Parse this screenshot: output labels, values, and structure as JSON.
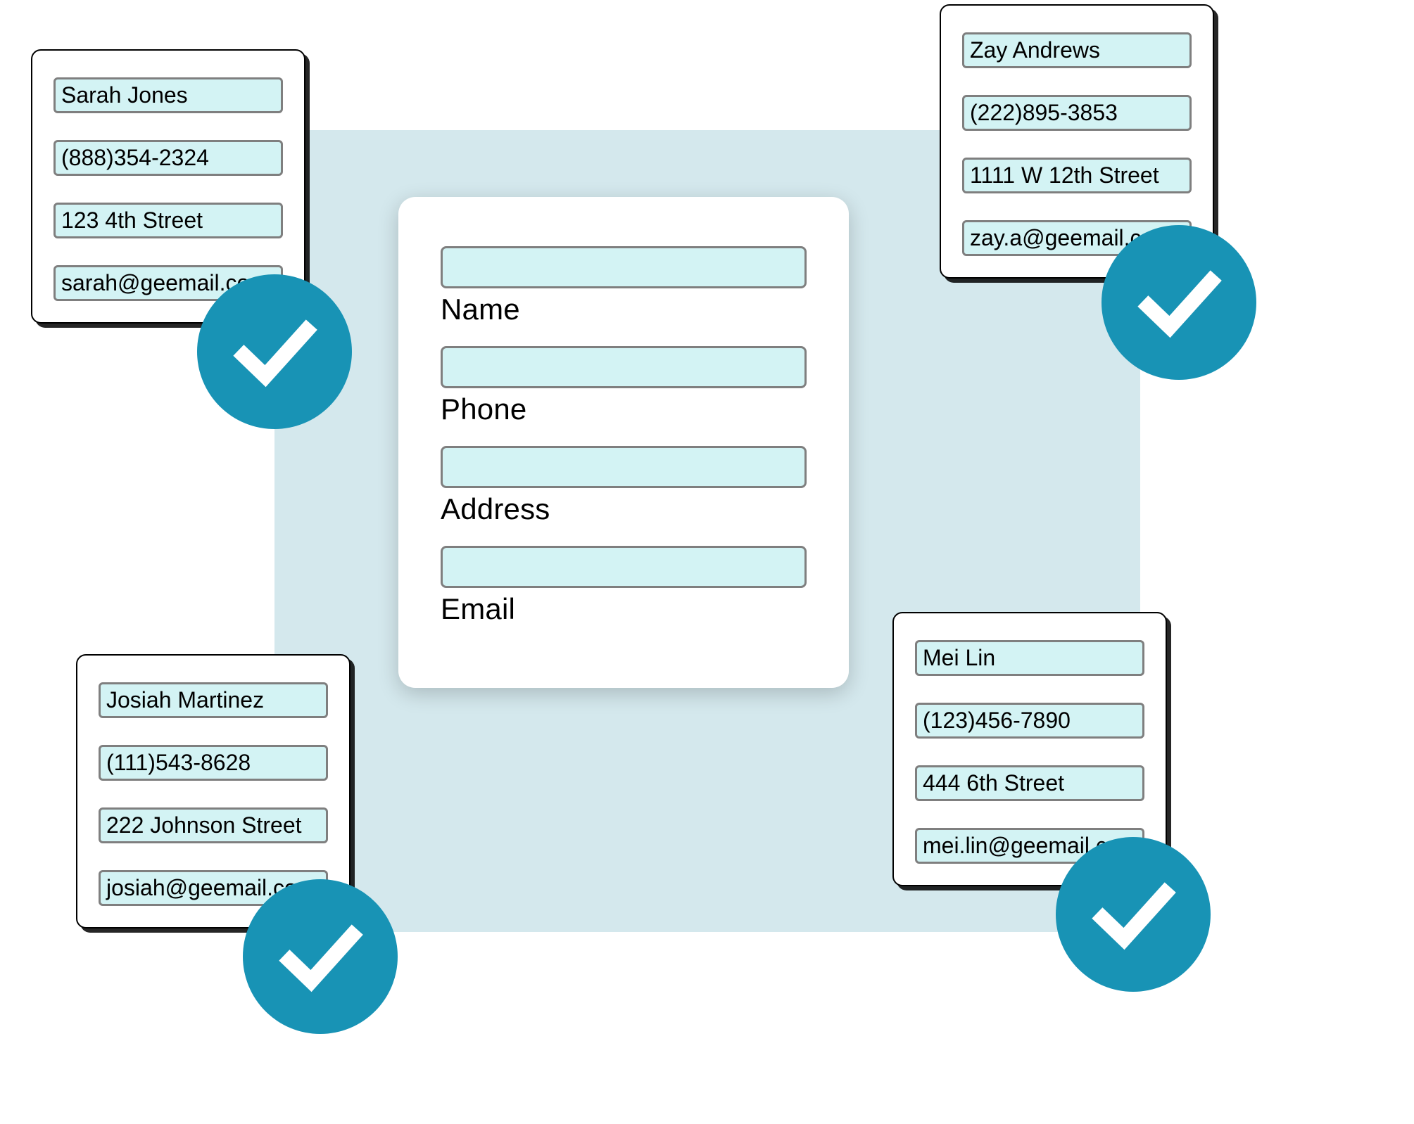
{
  "form": {
    "labels": {
      "name": "Name",
      "phone": "Phone",
      "address": "Address",
      "email": "Email"
    }
  },
  "contacts": [
    {
      "name": "Sarah Jones",
      "phone": "(888)354-2324",
      "address": "123 4th Street",
      "email": "sarah@geemail.com"
    },
    {
      "name": "Zay Andrews",
      "phone": "(222)895-3853",
      "address": "1111 W 12th Street",
      "email": "zay.a@geemail.com"
    },
    {
      "name": "Josiah Martinez",
      "phone": "(111)543-8628",
      "address": "222 Johnson Street",
      "email": "josiah@geemail.com"
    },
    {
      "name": "Mei Lin",
      "phone": "(123)456-7890",
      "address": "444 6th Street",
      "email": "mei.lin@geemail.com"
    }
  ]
}
